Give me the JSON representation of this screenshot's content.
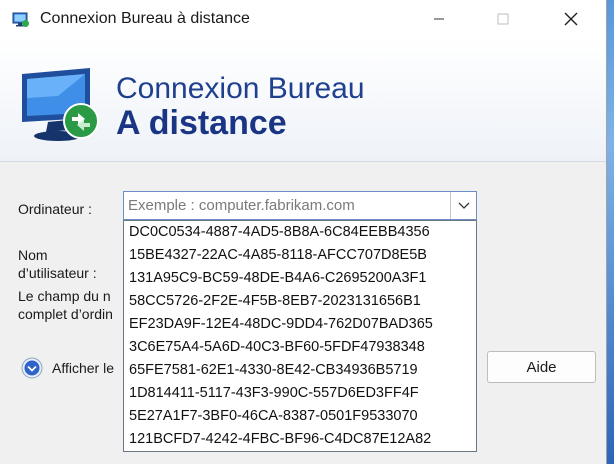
{
  "window": {
    "title": "Connexion Bureau à distance"
  },
  "banner": {
    "line1": "Connexion Bureau",
    "line2": "A distance"
  },
  "form": {
    "computer_label": "Ordinateur :",
    "computer_placeholder": "Exemple : computer.fabrikam.com",
    "computer_value": "",
    "username_label_1": "Nom",
    "username_label_2": "d’utilisateur :",
    "info_line_1": "Le champ du n",
    "info_line_2": "complet d’ordin"
  },
  "dropdown": {
    "options": [
      "DC0C0534-4887-4AD5-8B8A-6C84EEBB4356",
      "15BE4327-22AC-4A85-8118-AFCC707D8E5B",
      "131A95C9-BC59-48DE-B4A6-C2695200A3F1",
      "58CC5726-2F2E-4F5B-8EB7-2023131656B1",
      "EF23DA9F-12E4-48DC-9DD4-762D07BAD365",
      "3C6E75A4-5A6D-40C3-BF60-5FDF47938348",
      "65FE7581-62E1-4330-8E42-CB34936B5719",
      "1D814411-5117-43F3-990C-557D6ED3FF4F",
      "5E27A1F7-3BF0-46CA-8387-0501F9533070",
      "121BCFD7-4242-4FBC-BF96-C4DC87E12A82"
    ]
  },
  "footer": {
    "options_toggle_label": "Afficher le",
    "help_label": "Aide"
  },
  "icons": {
    "app": "remote-desktop-icon",
    "banner": "remote-desktop-monitor-icon",
    "toggle": "chevron-down-circle-icon"
  },
  "colors": {
    "banner_text": "#1f3f8f",
    "combo_border": "#6b8fc4",
    "toggle_icon": "#2c62c9"
  }
}
